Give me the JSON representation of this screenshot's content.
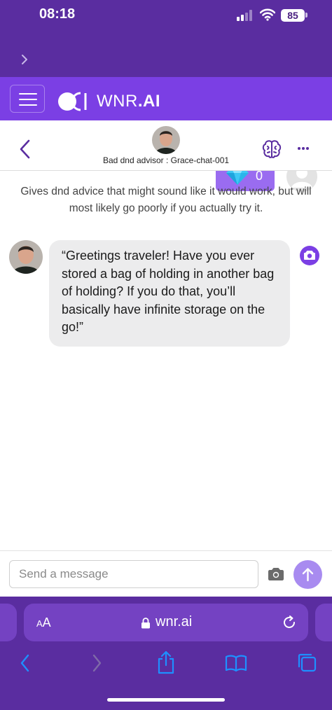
{
  "status_bar": {
    "time": "08:18",
    "battery": "85",
    "collapsed_tabs_icon": "chevron-right-icon"
  },
  "header": {
    "menu_icon": "hamburger-icon",
    "logo_text_main": "WNR",
    "logo_text_suffix": ".AI",
    "gem_icon": "diamond-icon",
    "gem_count": "0",
    "avatar_icon": "user-avatar-icon"
  },
  "chat": {
    "title": "Bad dnd advisor : Grace-chat-001",
    "description": "Gives dnd advice that might sound like it would work, but will most likely go poorly if you actually try it.",
    "messages": [
      {
        "sender": "bot",
        "text": "“Greetings traveler! Have you ever stored a bag of holding in another bag of holding? If you do that, you’ll basically have infinite storage on the go!”"
      }
    ]
  },
  "composer": {
    "placeholder": "Send a message",
    "value": ""
  },
  "browser": {
    "aa_big": "A",
    "aa_small": "A",
    "url": "wnr.ai",
    "toolbar": [
      "back-icon",
      "forward-icon",
      "share-icon",
      "bookmarks-icon",
      "tabs-icon"
    ]
  },
  "colors": {
    "accent": "#7b3fe4",
    "status_bg": "#5a2da0",
    "bubble_bg": "#ececed",
    "send_btn": "#a88bf0",
    "gem": "#3fc8f5"
  }
}
